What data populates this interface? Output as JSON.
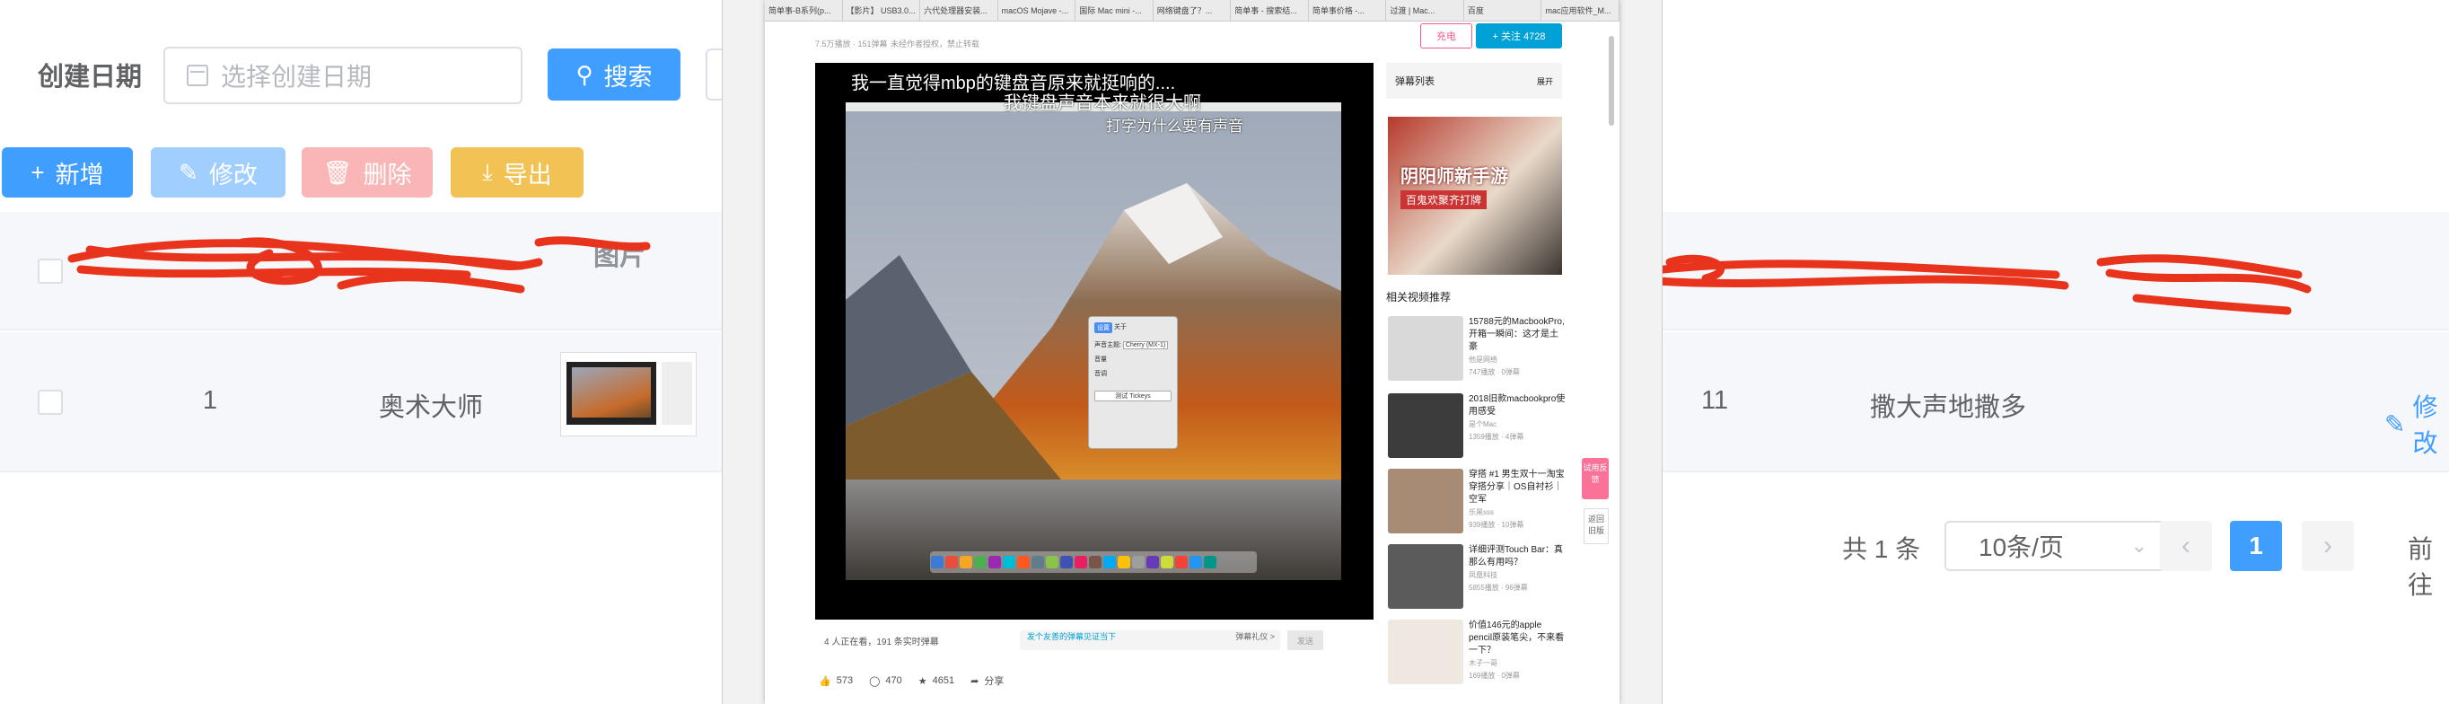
{
  "search": {
    "date_label": "创建日期",
    "date_placeholder": "选择创建日期",
    "search_label": "搜索"
  },
  "toolbar": {
    "add_label": "新增",
    "edit_label": "修改",
    "delete_label": "删除",
    "export_label": "导出"
  },
  "table": {
    "header_image_label": "图片",
    "row": {
      "index": "1",
      "name": "奥术大师",
      "count": "11",
      "desc": "撒大声地撒多",
      "action": "修改"
    }
  },
  "pagination": {
    "total": "共 1 条",
    "page_size": "10条/页",
    "current": "1",
    "goto": "前往"
  },
  "embedded": {
    "tabs": [
      "简单事-B系列(p...",
      "【影片】 USB3.0...",
      "六代处理器安装...",
      "macOS Mojave -...",
      "国际 Mac mini -...",
      "网络键盘了？...",
      "简单事 - 搜索结...",
      "简单事价格 -...",
      "过渡 | Mac...",
      "百度",
      "mac应用软件_M..."
    ],
    "meta_views": "7.5万播放 · 151弹幕",
    "meta_notice": "未经作者授权，禁止转载",
    "charge_label": "充电",
    "follow_label": "+ 关注 4728",
    "danmaku_1": "我一直觉得mbp的键盘音原来就挺响的....",
    "danmaku_2": "我键盘声音本来就很大啊",
    "danmaku_3": "打字为什么要有声音",
    "dialog_field_1": "声音主题:",
    "dialog_field_1_value": "Cherry (MX-1)",
    "dialog_field_2": "音量",
    "dialog_field_3": "音调",
    "dialog_button": "测试 Tickeys",
    "viewers": "4 人正在看，191 条实时弹幕",
    "danmaku_placeholder": "发个友善的弹幕见证当下",
    "danmaku_etiquette": "弹幕礼仪 >",
    "send_label": "发送",
    "likes": "573",
    "coins": "470",
    "favorites": "4651",
    "share_label": "分享",
    "danmaku_list_label": "弹幕列表",
    "expand_label": "展开",
    "ad_title": "阴阳师新手游",
    "ad_sub": "百鬼欢聚齐打牌",
    "rec_title": "相关视频推荐",
    "recs": [
      {
        "title": "15788元的MacbookPro,开箱一瞬间：这才是土豪",
        "author": "他是网络",
        "stats": "747播放 · 0弹幕"
      },
      {
        "title": "2018旧款macbookpro使用感受",
        "author": "是个Mac",
        "stats": "1359播放 · 4弹幕"
      },
      {
        "title": "穿搭 #1 男生双十一淘宝穿搭分享｜OS自衬衫｜空军",
        "author": "乐黑sss",
        "stats": "939播放 · 10弹幕"
      },
      {
        "title": "详细评测Touch Bar：真那么有用吗？",
        "author": "凤凰科技",
        "stats": "5855播放 · 96弹幕"
      },
      {
        "title": "价值146元的apple pencil原装笔尖，不来看一下？",
        "author": "木子一哥",
        "stats": "169播放 · 0弹幕"
      }
    ],
    "float_label": "试用反馈",
    "back_label": "返回旧版"
  },
  "colors": {
    "primary": "#409eff",
    "primary_light": "#a0cfff",
    "danger_light": "#fab6b6",
    "warning": "#f3c254",
    "redact": "#e8341c"
  },
  "icons": {
    "calendar": "calendar-icon",
    "search": "search-icon",
    "add": "plus-icon",
    "edit": "pencil-icon",
    "delete": "trash-icon",
    "export": "download-icon"
  }
}
